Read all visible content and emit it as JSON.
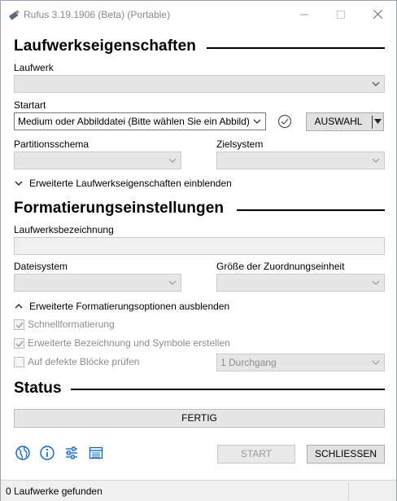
{
  "window": {
    "title": "Rufus 3.19.1906 (Beta) (Portable)"
  },
  "drive_properties": {
    "heading": "Laufwerkseigenschaften",
    "device_label": "Laufwerk",
    "device_value": "",
    "boot_label": "Startart",
    "boot_value": "Medium oder Abbilddatei (Bitte wählen Sie ein Abbild)",
    "select_button": "AUSWAHL",
    "partition_label": "Partitionsschema",
    "partition_value": "",
    "target_label": "Zielsystem",
    "target_value": "",
    "advanced_toggle": "Erweiterte Laufwerkseigenschaften einblenden"
  },
  "format_options": {
    "heading": "Formatierungseinstellungen",
    "volume_label": "Laufwerksbezeichnung",
    "volume_value": "",
    "fs_label": "Dateisystem",
    "fs_value": "",
    "cluster_label": "Größe der Zuordnungseinheit",
    "cluster_value": "",
    "advanced_toggle": "Erweiterte Formatierungsoptionen ausblenden",
    "quick_format": "Schnellformatierung",
    "quick_format_checked": true,
    "extended_label": "Erweiterte Bezeichnung und Symbole erstellen",
    "extended_label_checked": true,
    "bad_blocks": "Auf defekte Blöcke prüfen",
    "bad_blocks_checked": false,
    "passes_value": "1 Durchgang"
  },
  "status": {
    "heading": "Status",
    "progress_text": "FERTIG"
  },
  "actions": {
    "icons": [
      "globe-icon",
      "info-icon",
      "settings-sliders-icon",
      "log-icon"
    ],
    "start": "START",
    "close": "SCHLIESSEN"
  },
  "statusbar": {
    "message": "0 Laufwerke gefunden"
  },
  "colors": {
    "accent": "#0a64c8",
    "disabled_text": "#8c8c8c"
  }
}
